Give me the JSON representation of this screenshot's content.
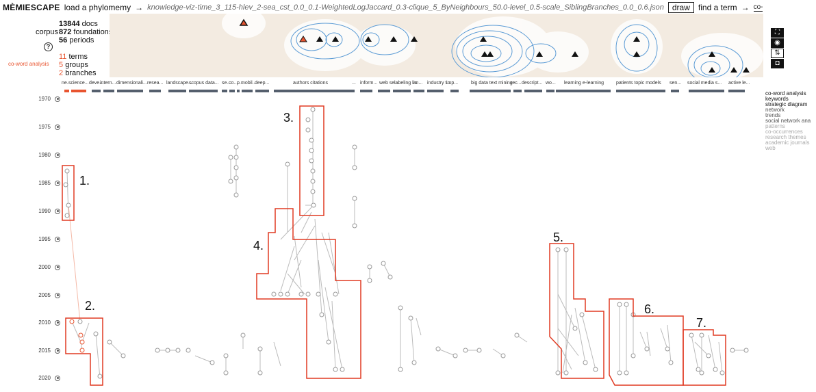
{
  "header": {
    "brand": "MÈMIESCAPE",
    "load_label": "load a phylomemy",
    "arrow": "→",
    "file_path": "knowledge-viz-time_3_115-hlev_2-sea_cst_0.0_0.1-WeightedLogJaccard_0.3-clique_5_ByNeighbours_50.0-level_0.5-scale_SiblingBranches_0.0_0.6.json",
    "draw_label": "draw",
    "find_label": "find a term",
    "search_value": "co-word analysis"
  },
  "corpus": {
    "docs": "13844",
    "docs_label": "docs",
    "corpus_label": "corpus",
    "foundations": "872",
    "foundations_label": "foundations",
    "periods": "56",
    "periods_label": "periods",
    "help": "?"
  },
  "selection": {
    "term": "co-word analysis",
    "terms": "11",
    "terms_label": "terms",
    "groups": "5",
    "groups_label": "groups",
    "branches": "2",
    "branches_label": "branches"
  },
  "controls": [
    {
      "name": "fullscreen-icon",
      "glyph": "⛶"
    },
    {
      "name": "center-icon",
      "glyph": "◉"
    },
    {
      "name": "sort-icon",
      "glyph": "⇅"
    },
    {
      "name": "camera-icon",
      "glyph": "◘"
    }
  ],
  "branch_labels": [
    "ne...",
    "science...",
    "deve...",
    "intern...",
    "dimensionali...",
    "resea...",
    "landscape...",
    "scopus data...",
    "se...",
    "co...",
    "p...",
    "mobil...",
    "deep...",
    "authors citations",
    "...",
    "inform...",
    "web se...",
    "labeling la...",
    "im...",
    "industry t...",
    "imp...",
    "big data text mining",
    "rec...",
    "descript...",
    "wo...",
    "learning e-learning",
    "patients topic models",
    "sen...",
    "social media s...",
    "active le..."
  ],
  "years": [
    "1970",
    "1975",
    "1980",
    "1985",
    "1990",
    "1995",
    "2000",
    "2005",
    "2010",
    "2015",
    "2020"
  ],
  "legend": [
    "co-word analysis",
    "keywords",
    "strategic diagram",
    "network",
    "trends",
    "social network ana",
    "patterns",
    "co-occurrences",
    "research themes",
    "academic journals",
    "web"
  ],
  "callouts": [
    "1.",
    "2.",
    "3.",
    "4.",
    "5.",
    "6.",
    "7."
  ],
  "colors": {
    "accent": "#e8542f",
    "landscape": "#f3ebe1",
    "contour": "#5b9bd5",
    "bars": "#555f6d"
  }
}
